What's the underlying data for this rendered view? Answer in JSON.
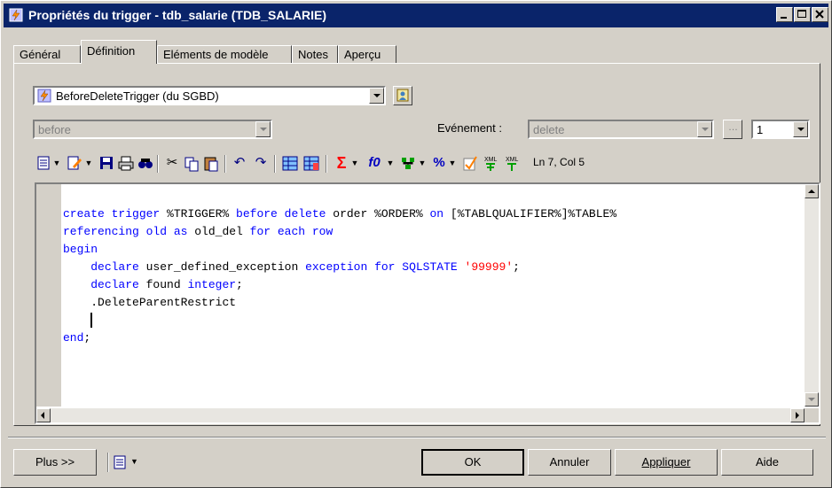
{
  "window": {
    "title": "Propriétés du trigger - tdb_salarie (TDB_SALARIE)"
  },
  "tabs": [
    {
      "label": "Général"
    },
    {
      "label": "Définition"
    },
    {
      "label": "Eléments de modèle"
    },
    {
      "label": "Notes"
    },
    {
      "label": "Aperçu"
    }
  ],
  "definition": {
    "template_select": "BeforeDeleteTrigger (du SGBD)",
    "time_select": "before",
    "event_label": "Evénement :",
    "event_select": "delete",
    "order_select": "1",
    "cursor_position": "Ln 7, Col 5"
  },
  "code": {
    "line1": {
      "k1": "create trigger",
      "t1": " %TRIGGER% ",
      "k2": "before delete",
      "t2": " order %ORDER% ",
      "k3": "on",
      "t3": " [%TABLQUALIFIER%]%TABLE%"
    },
    "line2": {
      "k1": "referencing old as",
      "t1": " old_del ",
      "k2": "for each row"
    },
    "line3": {
      "k1": "begin"
    },
    "line4": {
      "k1": "declare",
      "t1": " user_defined_exception ",
      "k2": "exception for SQLSTATE",
      "t2": " ",
      "s1": "'99999'",
      "t3": ";"
    },
    "line5": {
      "k1": "declare",
      "t1": " found ",
      "k2": "integer",
      "t2": ";"
    },
    "line6": {
      "t1": ".DeleteParentRestrict"
    },
    "line8": {
      "k1": "end",
      "t1": ";"
    }
  },
  "footer": {
    "more": "Plus >>",
    "ok": "OK",
    "cancel": "Annuler",
    "apply": "Appliquer",
    "help": "Aide"
  },
  "colors": {
    "titlebar": "#0a246a",
    "keyword": "#0000ff",
    "string": "#ff0000",
    "face": "#d4d0c8"
  }
}
